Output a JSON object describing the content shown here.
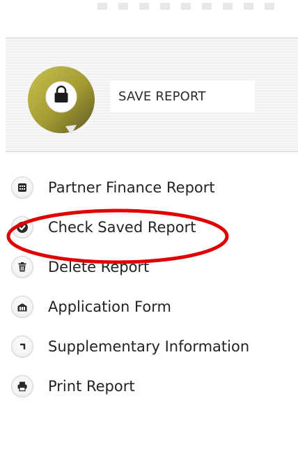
{
  "save_report": {
    "label": "SAVE REPORT",
    "icon": "lock-icon",
    "badge_color": "#b4ad42"
  },
  "menu": {
    "items": [
      {
        "label": "Partner Finance Report",
        "icon": "calculator-icon"
      },
      {
        "label": "Check Saved Report",
        "icon": "check-circle-icon"
      },
      {
        "label": "Delete Report",
        "icon": "trash-icon"
      },
      {
        "label": "Application Form",
        "icon": "building-icon"
      },
      {
        "label": "Supplementary Information",
        "icon": "corner-arrow-icon"
      },
      {
        "label": "Print Report",
        "icon": "printer-icon"
      }
    ]
  },
  "annotation": {
    "highlight_color": "#e10000",
    "highlighted_item": "Check Saved Report"
  }
}
